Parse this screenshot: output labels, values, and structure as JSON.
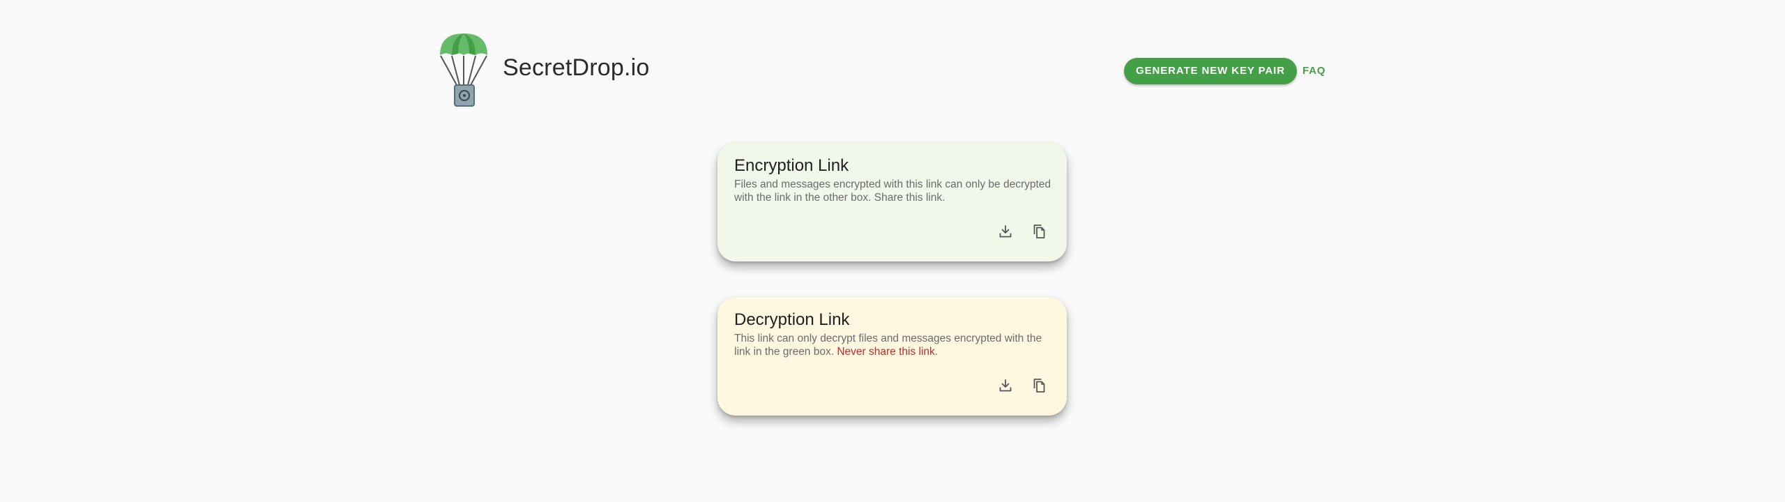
{
  "header": {
    "site_title": "SecretDrop.io",
    "logo_icon": "parachute-safe-logo",
    "generate_button_label": "GENERATE NEW KEY PAIR",
    "faq_label": "FAQ"
  },
  "encryption_card": {
    "title": "Encryption Link",
    "description": "Files and messages encrypted with this link can only be decrypted with the link in the other box. Share this link.",
    "download_icon": "download-icon",
    "copy_icon": "copy-icon"
  },
  "decryption_card": {
    "title": "Decryption Link",
    "description": "This link can only decrypt files and messages encrypted with the link in the green box. ",
    "warning": "Never share this link",
    "warning_suffix": ".",
    "download_icon": "download-icon",
    "copy_icon": "copy-icon"
  },
  "colors": {
    "accent": "#43a047",
    "encryption_bg": "#f1f8e9",
    "decryption_bg": "#fff8e1",
    "warning": "#c62828",
    "page_bg": "#fafafa"
  }
}
